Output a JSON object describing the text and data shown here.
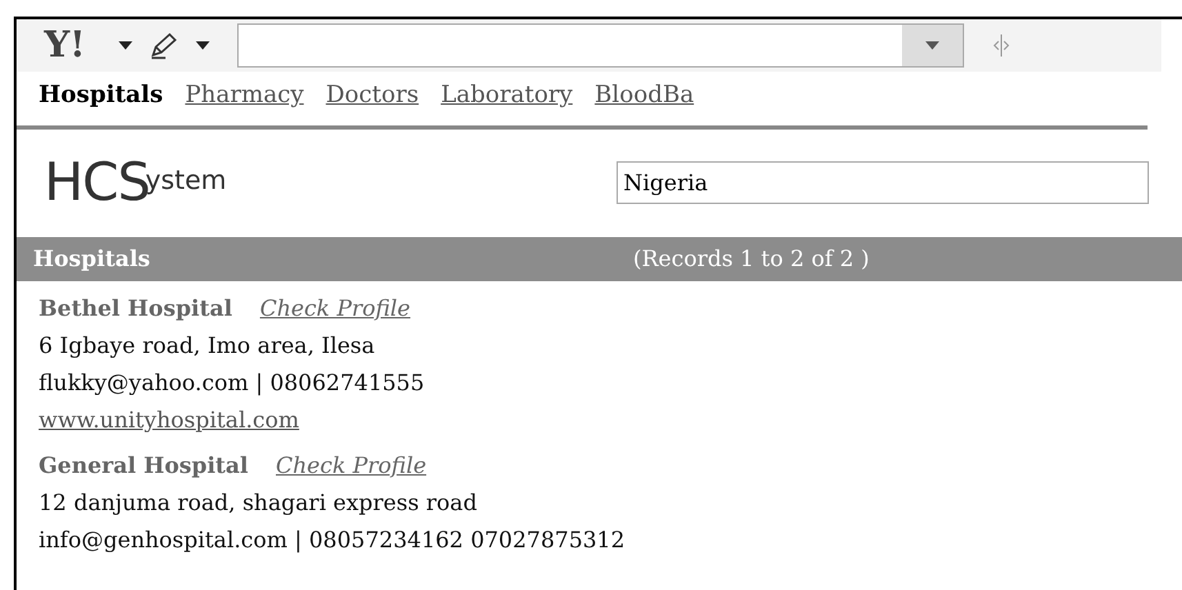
{
  "toolbar": {
    "logo": "Y!"
  },
  "nav": [
    {
      "label": "Hospitals",
      "selected": true
    },
    {
      "label": "Pharmacy",
      "selected": false
    },
    {
      "label": "Doctors",
      "selected": false
    },
    {
      "label": "Laboratory",
      "selected": false
    },
    {
      "label": "BloodBa",
      "selected": false
    }
  ],
  "brand": {
    "initials": "HCS",
    "suffix": "ystem"
  },
  "country_field": {
    "value": "Nigeria"
  },
  "results_header": {
    "title": "Hospitals",
    "records": "(Records 1 to 2 of 2 )"
  },
  "hospitals": [
    {
      "name": "Bethel Hospital",
      "link": "Check Profile",
      "address": "6 Igbaye road, Imo area, Ilesa",
      "contact": "flukky@yahoo.com | 08062741555",
      "website": "www.unityhospital.com"
    },
    {
      "name": "General Hospital",
      "link": "Check Profile",
      "address": "12 danjuma road, shagari express road",
      "contact": "info@genhospital.com | 08057234162 07027875312"
    }
  ]
}
